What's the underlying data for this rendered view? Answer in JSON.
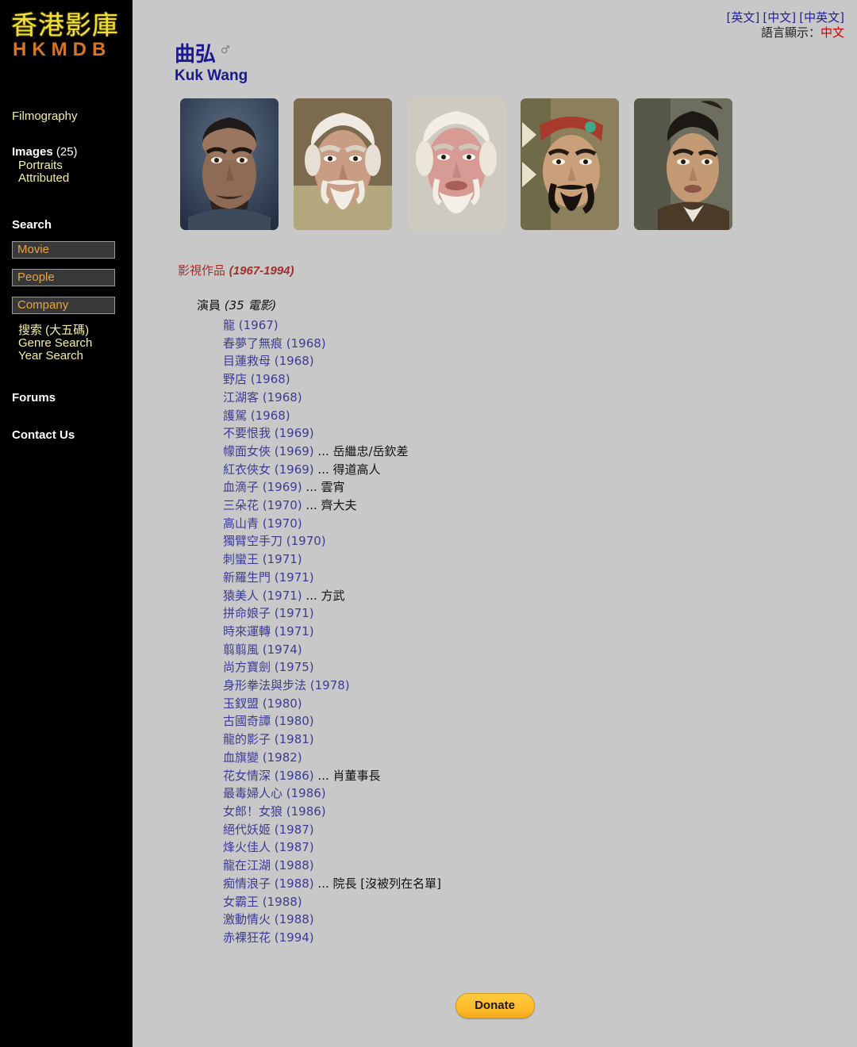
{
  "site": {
    "logo_cn": "香港影庫",
    "logo_en": "HKMDB"
  },
  "sidebar": {
    "filmography_label": "Filmography",
    "images": {
      "label": "Images",
      "count": "(25)",
      "sub_items": [
        {
          "label": "Portraits"
        },
        {
          "label": "Attributed"
        }
      ]
    },
    "search": {
      "title": "Search",
      "boxes": [
        {
          "name": "movie",
          "value": "Movie"
        },
        {
          "name": "people",
          "value": "People"
        },
        {
          "name": "company",
          "value": "Company"
        }
      ],
      "links": [
        {
          "label": "搜索 (大五碼)"
        },
        {
          "label": "Genre Search"
        },
        {
          "label": "Year Search"
        }
      ]
    },
    "forums_label": "Forums",
    "contact_label": "Contact Us"
  },
  "language_bar": {
    "links": [
      {
        "label": "[英文]"
      },
      {
        "label": "[中文]"
      },
      {
        "label": "[中英文]"
      }
    ],
    "display_prefix": "語言顯示：",
    "display_current": "中文"
  },
  "person": {
    "name_cn": "曲弘",
    "gender_symbol": "♂",
    "name_en": "Kuk Wang"
  },
  "portraits": [
    {
      "alt": "portrait-1"
    },
    {
      "alt": "portrait-2"
    },
    {
      "alt": "portrait-3"
    },
    {
      "alt": "portrait-4"
    },
    {
      "alt": "portrait-5"
    }
  ],
  "filmography": {
    "heading": "影視作品 ",
    "years": "(1967-1994)",
    "groups": [
      {
        "role_label": "演員 ",
        "meta": "(35 電影)",
        "credits": [
          {
            "title": "龍 (1967)",
            "role": ""
          },
          {
            "title": "春夢了無痕 (1968)",
            "role": ""
          },
          {
            "title": "目蓮救母 (1968)",
            "role": ""
          },
          {
            "title": "野店 (1968)",
            "role": ""
          },
          {
            "title": "江湖客 (1968)",
            "role": ""
          },
          {
            "title": "護駕 (1968)",
            "role": ""
          },
          {
            "title": "不要恨我 (1969)",
            "role": ""
          },
          {
            "title": "幪面女俠 (1969)",
            "role": " ... 岳繼忠/岳欽差"
          },
          {
            "title": "紅衣俠女 (1969)",
            "role": " ... 得道高人"
          },
          {
            "title": "血滴子 (1969)",
            "role": " ... 雲宵"
          },
          {
            "title": "三朵花 (1970)",
            "role": " ... 齊大夫"
          },
          {
            "title": "高山青 (1970)",
            "role": ""
          },
          {
            "title": "獨臂空手刀 (1970)",
            "role": ""
          },
          {
            "title": "刺蠻王 (1971)",
            "role": ""
          },
          {
            "title": "新羅生門 (1971)",
            "role": ""
          },
          {
            "title": "猿美人 (1971)",
            "role": " ... 方武"
          },
          {
            "title": "拼命娘子 (1971)",
            "role": ""
          },
          {
            "title": "時來運轉 (1971)",
            "role": ""
          },
          {
            "title": "翦翦風 (1974)",
            "role": ""
          },
          {
            "title": "尚方寶劍 (1975)",
            "role": ""
          },
          {
            "title": "身形拳法與步法 (1978)",
            "role": ""
          },
          {
            "title": "玉釵盟 (1980)",
            "role": ""
          },
          {
            "title": "古國奇譚 (1980)",
            "role": ""
          },
          {
            "title": "龍的影子 (1981)",
            "role": ""
          },
          {
            "title": "血旗變 (1982)",
            "role": ""
          },
          {
            "title": "花女情深 (1986)",
            "role": " ... 肖董事長"
          },
          {
            "title": "最毒婦人心 (1986)",
            "role": ""
          },
          {
            "title": "女郎！女狼 (1986)",
            "role": ""
          },
          {
            "title": "絕代妖姬 (1987)",
            "role": ""
          },
          {
            "title": "烽火佳人 (1987)",
            "role": ""
          },
          {
            "title": "龍在江湖 (1988)",
            "role": ""
          },
          {
            "title": "痴情浪子 (1988)",
            "role": " ... 院長 [沒被列在名單]"
          },
          {
            "title": "女霸王 (1988)",
            "role": ""
          },
          {
            "title": "激動情火 (1988)",
            "role": ""
          },
          {
            "title": "赤裸狂花 (1994)",
            "role": ""
          }
        ]
      }
    ]
  },
  "footer": {
    "donate_label": "Donate"
  }
}
